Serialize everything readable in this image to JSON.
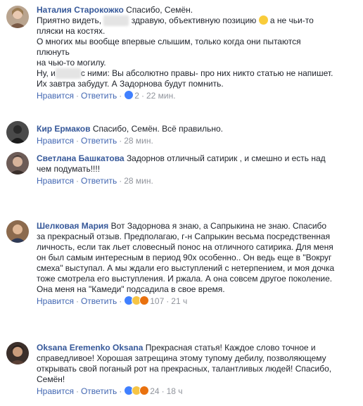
{
  "comments": [
    {
      "author": "Наталия Старокожко",
      "text_lines": [
        "Спасибо, Семён.",
        "Приятно видеть,",
        "здравую, объективную позицию",
        "а не чьи-то",
        "пляски на костях.",
        "О многих мы вообще впервые слышим, только когда они пытаются плюнуть",
        "на чью-то могилу.",
        "Ну, и",
        "с ними: Вы абсолютно правы- про них никто статью не напишет.",
        "Их завтра забудут. А Задорнова будут помнить."
      ],
      "like": "Нравится",
      "reply": "Ответить",
      "reactions": "2",
      "time": "22 мин."
    },
    {
      "author": "Кир Ермаков",
      "text_lines": [
        "Спасибо, Семён. Всё правильно."
      ],
      "like": "Нравится",
      "reply": "Ответить",
      "time": "28 мин."
    },
    {
      "author": "Светлана Башкатова",
      "text_lines": [
        "Задорнов отличный сатирик , и смешно и есть над",
        "чем подумать!!!!"
      ],
      "like": "Нравится",
      "reply": "Ответить",
      "time": "28 мин."
    },
    {
      "author": "Шелковая Мария",
      "text_lines": [
        "Вот Задорнова я знаю, а Сапрыкина не знаю. Спасибо",
        "за прекрасный отзыв. Предполагаю, г-н Сапрыкин весьма посредственная",
        "личность, если так льет словесный понос на отличного сатирика. Для меня",
        "он был самым интересным в период 90х особенно.. Он ведь еще в \"Вокруг",
        "смеха\" выступал. А мы ждали его выступлений с нетерпением, и моя дочка",
        "тоже смотрела его выступления. И ржала. А она совсем другое поколение.",
        "Она меня на \"Камеди\" подсадила в свое время."
      ],
      "like": "Нравится",
      "reply": "Ответить",
      "reactions": "107",
      "time": "21 ч"
    },
    {
      "author": "Oksana Eremenko Oksana",
      "text_lines": [
        "Прекрасная статья! Каждое слово точное и",
        "справедливое! Хорошая затрещина этому тупому дебилу, позволяющему",
        "открывать свой поганый рот на прекрасных, талантливых людей! Спасибо,",
        "Семён!"
      ],
      "like": "Нравится",
      "reply": "Ответить",
      "reactions": "24",
      "time": "18 ч"
    }
  ],
  "separator": "·"
}
